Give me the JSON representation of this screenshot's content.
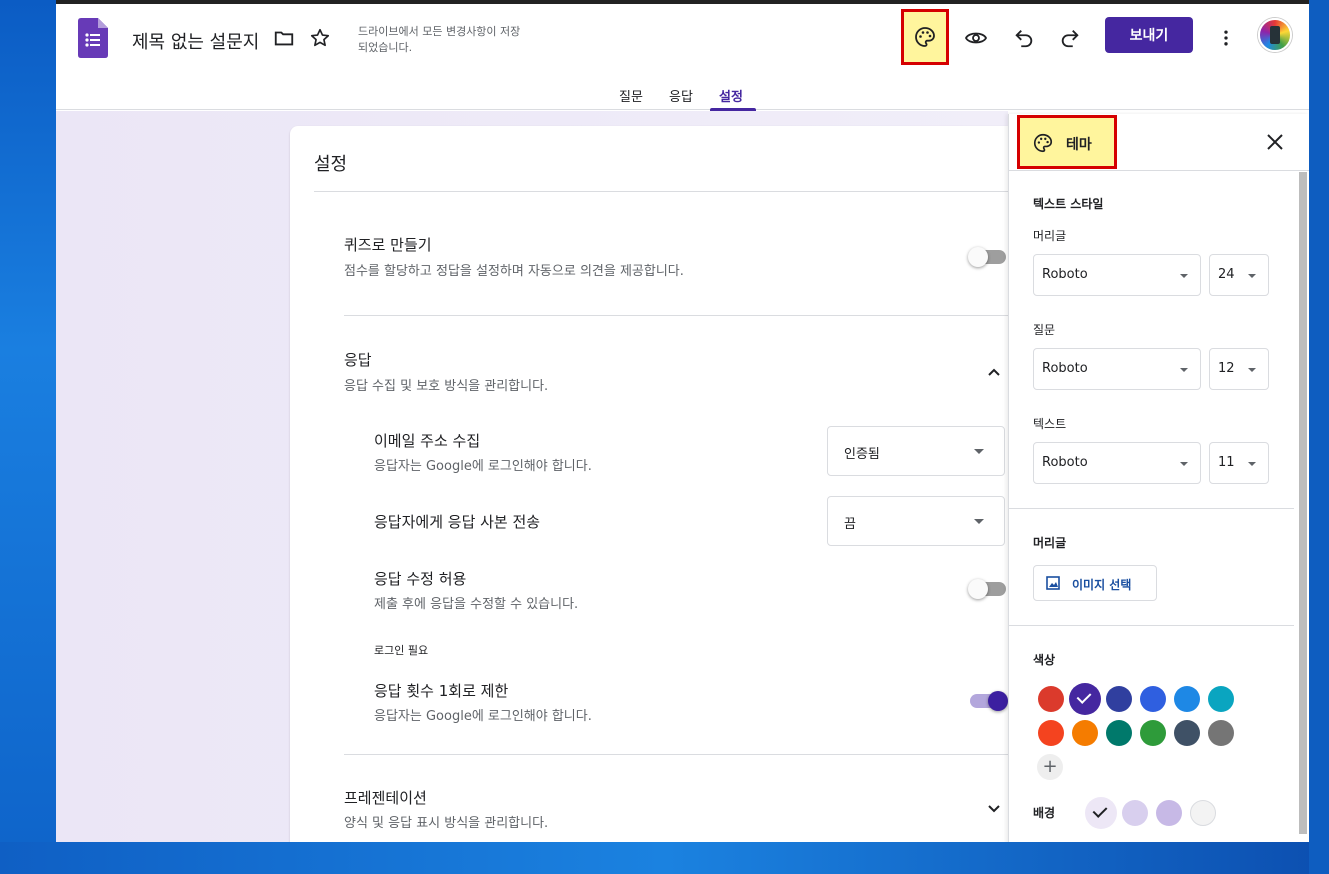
{
  "header": {
    "title": "제목 없는 설문지",
    "save_status": "드라이브에서 모든 변경사항이 저장되었습니다.",
    "send_label": "보내기",
    "tabs": [
      {
        "label": "질문"
      },
      {
        "label": "응답"
      },
      {
        "label": "설정"
      }
    ],
    "active_tab": "설정",
    "accent": "#4527a0"
  },
  "settings": {
    "card_title": "설정",
    "quiz": {
      "title": "퀴즈로 만들기",
      "desc": "점수를 할당하고 정답을 설정하며 자동으로 의견을 제공합니다.",
      "enabled": false
    },
    "responses": {
      "title": "응답",
      "desc": "응답 수집 및 보호 방식을 관리합니다.",
      "expanded": true,
      "email": {
        "title": "이메일 주소 수집",
        "desc": "응답자는 Google에 로그인해야 합니다.",
        "value": "인증됨"
      },
      "copy": {
        "title": "응답자에게 응답 사본 전송",
        "value": "끔"
      },
      "edit": {
        "title": "응답 수정 허용",
        "desc": "제출 후에 응답을 수정할 수 있습니다.",
        "enabled": false
      },
      "login_heading": "로그인 필요",
      "limit": {
        "title": "응답 횟수 1회로 제한",
        "desc": "응답자는 Google에 로그인해야 합니다.",
        "enabled": true
      }
    },
    "presentation": {
      "title": "프레젠테이션",
      "desc": "양식 및 응답 표시 방식을 관리합니다.",
      "expanded": false
    }
  },
  "theme": {
    "title": "테마",
    "text_style_label": "텍스트 스타일",
    "header_label": "머리글",
    "header_font": "Roboto",
    "header_size": "24",
    "question_label": "질문",
    "question_font": "Roboto",
    "question_size": "12",
    "text_label": "텍스트",
    "text_font": "Roboto",
    "text_size": "11",
    "header_image_label": "머리글",
    "image_button": "이미지 선택",
    "color_label": "색상",
    "colors": [
      "#db3a2c",
      "#4527a0",
      "#303f9f",
      "#2f5fe0",
      "#1e88e5",
      "#0aa5c0",
      "#f4431f",
      "#f57c00",
      "#00796b",
      "#2e9b3a",
      "#3f5166",
      "#757575"
    ],
    "selected_color": "#4527a0",
    "background_label": "배경",
    "backgrounds": [
      "#ede7f6",
      "#d8cfee",
      "#c7b9e6",
      "#f3f3f3"
    ],
    "selected_background": "#ede7f6"
  }
}
